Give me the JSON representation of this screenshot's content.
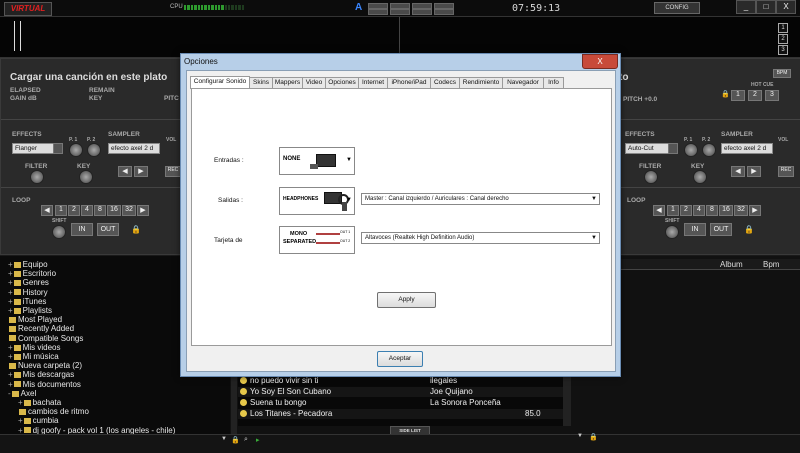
{
  "app": {
    "logo": "VIRTUAL DJ",
    "cpu_label": "CPU",
    "mode_letter": "A",
    "clock": "07:59:13",
    "config_label": "CONFIG",
    "window_controls": [
      "_",
      "□",
      "X"
    ]
  },
  "deck_left": {
    "title": "Cargar una canción en este plato",
    "elapsed": "ELAPSED",
    "remain": "REMAIN",
    "pitch": "PITC",
    "gain": "GAIN dB",
    "key": "KEY",
    "effects_label": "EFFECTS",
    "effect_selected": "Flanger",
    "p1": "P. 1",
    "p2": "P. 2",
    "sampler_label": "SAMPLER",
    "sampler_selected": "efecto axel 2 d",
    "vol": "VOL",
    "filter": "FILTER",
    "key_knob": "KEY",
    "rec": "REC",
    "loop_label": "LOOP",
    "loop_values": [
      "1",
      "2",
      "4",
      "8",
      "16",
      "32"
    ],
    "shift": "SHIFT",
    "in": "IN",
    "out": "OUT"
  },
  "deck_right": {
    "title_fragment": "to",
    "pitch": "PITCH +0.0",
    "hot_cue": "HOT CUE",
    "hot_cue_buttons": [
      "1",
      "2",
      "3"
    ],
    "bpm": "BPM",
    "effects_label": "EFFECTS",
    "effect_selected": "Auto-Cut",
    "p1": "P. 1",
    "p2": "P. 2",
    "sampler_label": "SAMPLER",
    "sampler_selected": "efecto axel 2 d",
    "vol": "VOL",
    "filter": "FILTER",
    "key_knob": "KEY",
    "rec": "REC",
    "loop_label": "LOOP",
    "loop_values": [
      "1",
      "2",
      "4",
      "8",
      "16",
      "32"
    ],
    "shift": "SHIFT",
    "in": "IN",
    "out": "OUT"
  },
  "deck_numbers": [
    "1",
    "2",
    "3"
  ],
  "browser": {
    "tree": [
      {
        "label": "Equipo",
        "level": 0,
        "expander": "+"
      },
      {
        "label": "Escritorio",
        "level": 0,
        "expander": "+"
      },
      {
        "label": "Genres",
        "level": 0,
        "expander": "+"
      },
      {
        "label": "History",
        "level": 0,
        "expander": "+"
      },
      {
        "label": "iTunes",
        "level": 0,
        "expander": "+"
      },
      {
        "label": "Playlists",
        "level": 0,
        "expander": "+"
      },
      {
        "label": "Most Played",
        "level": 0,
        "expander": ""
      },
      {
        "label": "Recently Added",
        "level": 0,
        "expander": ""
      },
      {
        "label": "Compatible Songs",
        "level": 0,
        "expander": ""
      },
      {
        "label": "Mis videos",
        "level": 0,
        "expander": "+"
      },
      {
        "label": "Mi música",
        "level": 0,
        "expander": "+"
      },
      {
        "label": "Nueva carpeta (2)",
        "level": 0,
        "expander": ""
      },
      {
        "label": "Mis descargas",
        "level": 0,
        "expander": "+"
      },
      {
        "label": "Mis documentos",
        "level": 0,
        "expander": "+"
      },
      {
        "label": "Axel",
        "level": 0,
        "expander": "-"
      },
      {
        "label": "bachata",
        "level": 1,
        "expander": "+"
      },
      {
        "label": "cambios de ritmo",
        "level": 1,
        "expander": ""
      },
      {
        "label": "cumbia",
        "level": 1,
        "expander": "+"
      },
      {
        "label": "dj goofy - pack vol 1 (los angeles - chile)",
        "level": 1,
        "expander": "+"
      }
    ],
    "columns": [
      "Album",
      "Bpm"
    ],
    "tracks": [
      {
        "title": "no puedo vivir sin ti",
        "artist": "ilegales",
        "bpm": ""
      },
      {
        "title": "Yo Soy El Son Cubano",
        "artist": "Joe Quijano",
        "bpm": ""
      },
      {
        "title": "Suena tu bongo",
        "artist": "La Sonora Ponceña",
        "bpm": ""
      },
      {
        "title": "Los Titanes - Pecadora",
        "artist": "",
        "bpm": "85.0"
      }
    ],
    "side_list": "SIDE LIST"
  },
  "dialog": {
    "title": "Opciones",
    "close": "X",
    "tabs": [
      "Configurar Sonido",
      "Skins",
      "Mappers",
      "Video",
      "Opciones",
      "Internet",
      "iPhone/iPad",
      "Codecs",
      "Rendimiento",
      "Navegador",
      "Info"
    ],
    "active_tab": 0,
    "entradas_label": "Entradas :",
    "entradas_value": "NONE",
    "salidas_label": "Salidas :",
    "salidas_value": "HEADPHONES",
    "salidas_select": "Master : Canal izquierdo / Auriculares : Canal derecho",
    "tarjeta_label": "Tarjeta de",
    "tarjeta_value_1": "MONO",
    "tarjeta_value_2": "SEPARATED",
    "tarjeta_select": "Altavoces (Realtek High Definition Audio)",
    "out1": "OUT 1",
    "out2": "OUT 2",
    "apply": "Apply",
    "accept": "Aceptar"
  }
}
